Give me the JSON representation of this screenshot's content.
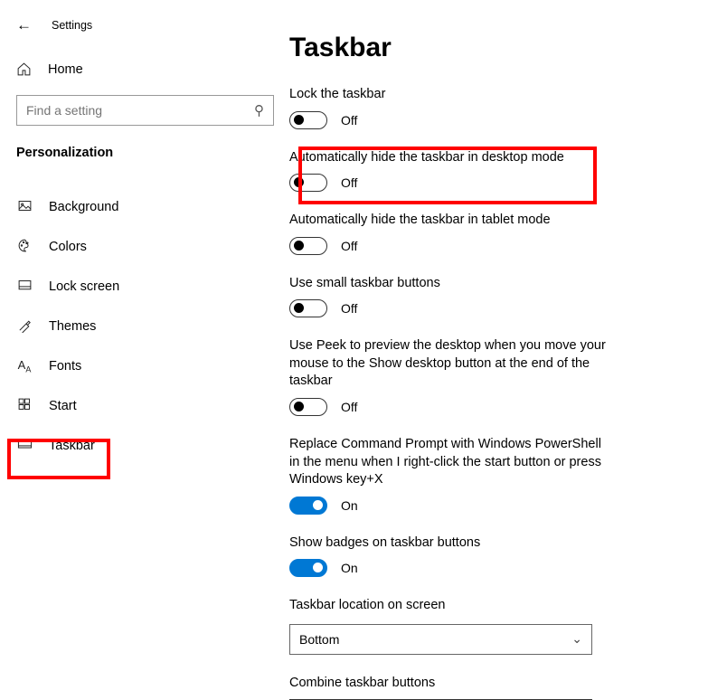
{
  "app_title": "Settings",
  "home_label": "Home",
  "search_placeholder": "Find a setting",
  "section_title": "Personalization",
  "nav": [
    {
      "label": "Background"
    },
    {
      "label": "Colors"
    },
    {
      "label": "Lock screen"
    },
    {
      "label": "Themes"
    },
    {
      "label": "Fonts"
    },
    {
      "label": "Start"
    },
    {
      "label": "Taskbar"
    }
  ],
  "page_title": "Taskbar",
  "settings": [
    {
      "label": "Lock the taskbar",
      "state": "Off",
      "on": false
    },
    {
      "label": "Automatically hide the taskbar in desktop mode",
      "state": "Off",
      "on": false
    },
    {
      "label": "Automatically hide the taskbar in tablet mode",
      "state": "Off",
      "on": false
    },
    {
      "label": "Use small taskbar buttons",
      "state": "Off",
      "on": false
    },
    {
      "label": "Use Peek to preview the desktop when you move your mouse to the Show desktop button at the end of the taskbar",
      "state": "Off",
      "on": false
    },
    {
      "label": "Replace Command Prompt with Windows PowerShell in the menu when I right-click the start button or press Windows key+X",
      "state": "On",
      "on": true
    },
    {
      "label": "Show badges on taskbar buttons",
      "state": "On",
      "on": true
    }
  ],
  "location_label": "Taskbar location on screen",
  "location_value": "Bottom",
  "combine_label": "Combine taskbar buttons"
}
